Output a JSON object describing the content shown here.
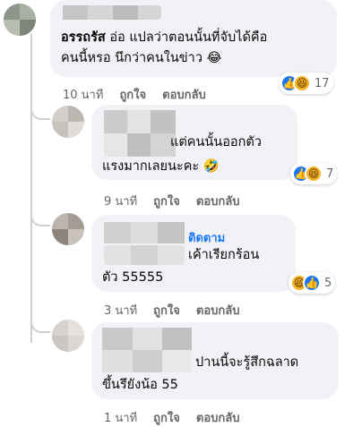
{
  "comments": [
    {
      "author": "อรรถรัส",
      "text_line1": "อ่อ แปลว่าตอนนั้นที่จับได้คือ",
      "text_line2": "คนนี้หรอ นึกว่าคนในข่าว",
      "emoji": "😂",
      "time": "10 นาที",
      "like_label": "ถูกใจ",
      "reply_label": "ตอบกลับ",
      "reaction_count": "17"
    },
    {
      "text_line1": "แต่คนนั้นออกตัว",
      "text_line2": "แรงมากเลยนะคะ",
      "emoji": "🤣",
      "time": "9 นาที",
      "like_label": "ถูกใจ",
      "reply_label": "ตอบกลับ",
      "reaction_count": "7"
    },
    {
      "follow_label": "ติดตาม",
      "text_line1": "เค้าเรียกร้อน",
      "text_line2": "ตัว 55555",
      "time": "3 นาที",
      "like_label": "ถูกใจ",
      "reply_label": "ตอบกลับ",
      "reaction_count": "5"
    },
    {
      "text_line1": "ปานนี้จะรู้สึกฉลาด",
      "text_line2": "ขึ้นรึยังน้อ 55",
      "time": "1 นาที",
      "like_label": "ถูกใจ",
      "reply_label": "ตอบกลับ"
    }
  ],
  "reaction_icons": [
    "like-icon",
    "haha-icon"
  ],
  "colors": {
    "bubble": "#f0f2f5",
    "meta": "#65676b",
    "link": "#1877f2"
  }
}
